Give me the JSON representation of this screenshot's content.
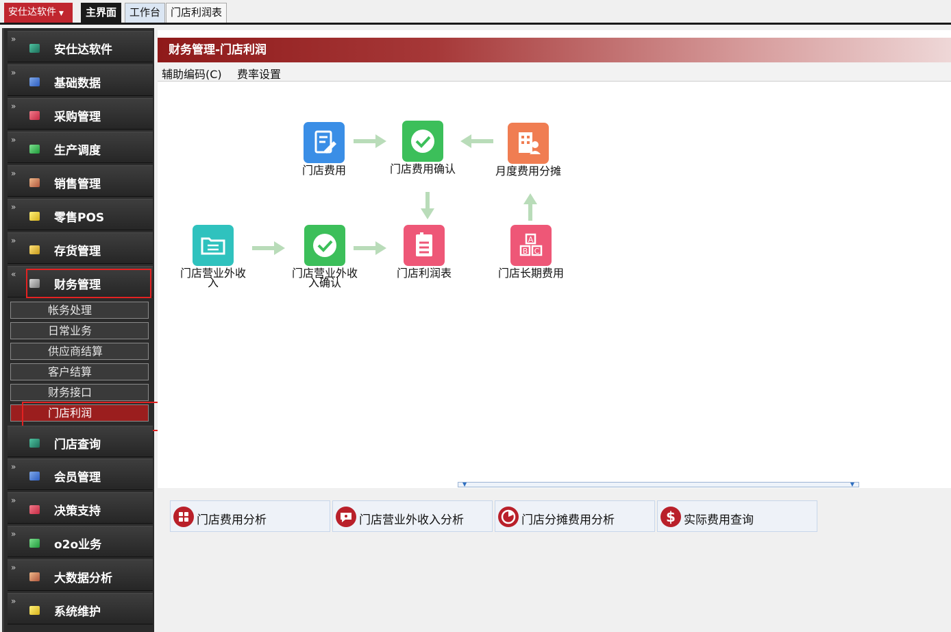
{
  "topbar": {
    "brand": "安仕达软件",
    "tabs": [
      "主界面",
      "工作台",
      "门店利润表"
    ]
  },
  "sidebar": {
    "modules": [
      "安仕达软件",
      "基础数据",
      "采购管理",
      "生产调度",
      "销售管理",
      "零售POS",
      "存货管理",
      "财务管理"
    ],
    "finance_subitems": [
      "帐务处理",
      "日常业务",
      "供应商结算",
      "客户结算",
      "财务接口",
      "门店利润"
    ],
    "modules_after": [
      "门店查询",
      "会员管理",
      "决策支持",
      "o2o业务",
      "大数据分析",
      "系统维护"
    ]
  },
  "main": {
    "title": "财务管理-门店利润",
    "toolbar": [
      "辅助编码(C)",
      "费率设置"
    ],
    "nodes": [
      "门店费用",
      "门店费用确认",
      "月度费用分摊",
      "门店营业外收入",
      "门店营业外收入确认",
      "门店利润表",
      "门店长期费用"
    ],
    "quick_buttons": [
      "门店费用分析",
      "门店营业外收入分析",
      "门店分摊费用分析",
      "实际费用查询"
    ]
  },
  "colors": {
    "brand": "#c0262f",
    "header_start": "#8f1a1a",
    "active_sub": "#9b1e1e",
    "highlight_box": "#e32222",
    "arrow": "#b9dcb9"
  }
}
